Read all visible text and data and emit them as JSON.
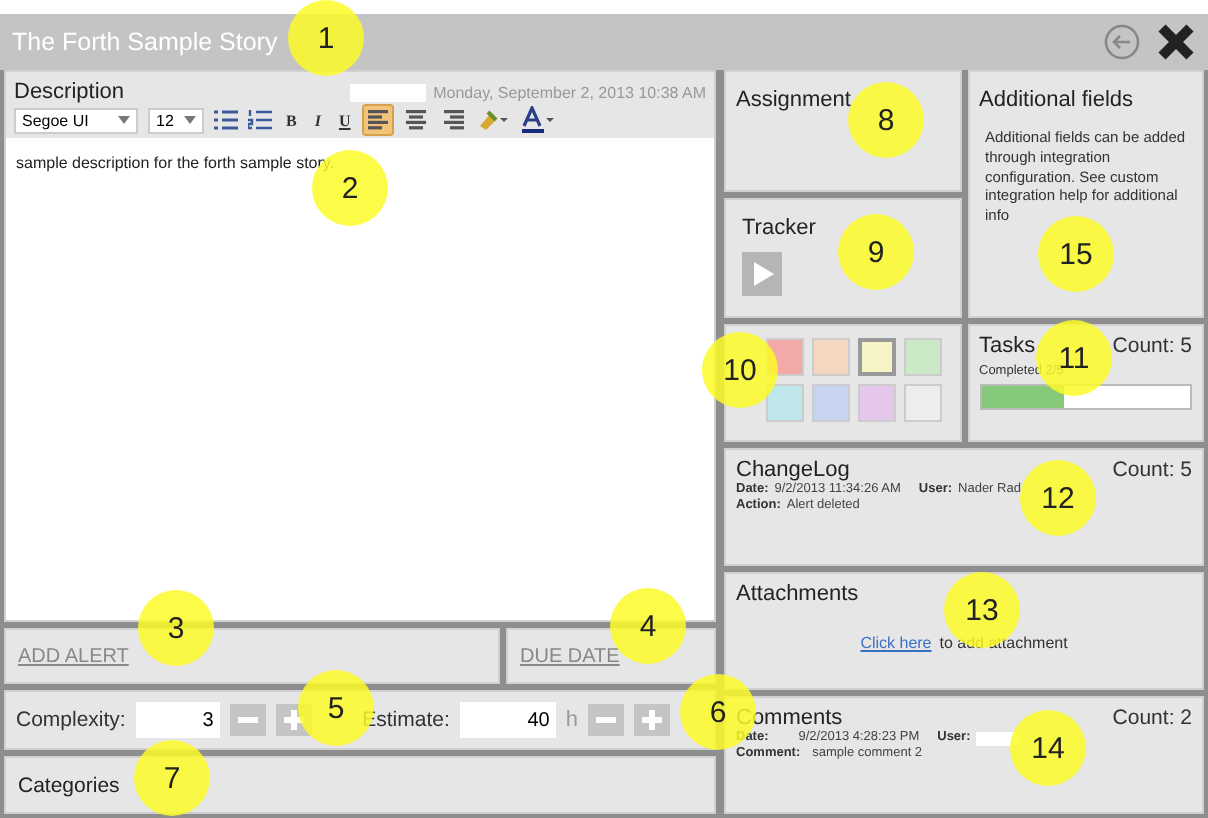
{
  "window": {
    "title": "The Forth Sample Story"
  },
  "description": {
    "title": "Description",
    "date": "Monday, September 2, 2013 10:38 AM",
    "font": "Segoe UI",
    "size": "12",
    "format_buttons": [
      "B",
      "I",
      "U"
    ],
    "align": [
      {
        "kind": "left",
        "selected": true
      },
      {
        "kind": "center",
        "selected": false
      },
      {
        "kind": "right",
        "selected": false
      }
    ],
    "text": "sample description for the forth sample story."
  },
  "add_alert": "ADD ALERT",
  "due_date": "DUE DATE",
  "complexity": {
    "label": "Complexity:",
    "value": "3"
  },
  "estimate": {
    "label": "Estimate:",
    "value": "40",
    "unit": "h"
  },
  "categories": {
    "title": "Categories"
  },
  "assignment": {
    "title": "Assignment"
  },
  "tracker": {
    "title": "Tracker"
  },
  "colors": [
    {
      "color": "#f4a9a9",
      "selected": false
    },
    {
      "color": "#f4d7be",
      "selected": false
    },
    {
      "color": "#f6f3c4",
      "selected": true
    },
    {
      "color": "#cbe9c7",
      "selected": false
    },
    {
      "color": "#bfe7ea",
      "selected": false
    },
    {
      "color": "#c7d4f1",
      "selected": false
    },
    {
      "color": "#e6c7ec",
      "selected": false
    },
    {
      "color": "#ededed",
      "selected": false
    }
  ],
  "additional_fields": {
    "title": "Additional fields",
    "text": "Additional fields can be added through integration configuration. See custom integration help for additional info"
  },
  "tasks": {
    "title": "Tasks",
    "count": "Count: 5",
    "completed": "Completed  2/5",
    "level": 0.4
  },
  "changelog": {
    "title": "ChangeLog",
    "count": "Count: 5",
    "entries": [
      {
        "date_label": "Date:",
        "date": "9/2/2013 11:34:26 AM",
        "user_label": "User:",
        "user": "Nader Rad",
        "action_label": "Action:",
        "action": "Alert deleted"
      }
    ]
  },
  "attachments": {
    "title": "Attachments",
    "link": "Click here",
    "text": "to add attachment"
  },
  "comments": {
    "title": "Comments",
    "count": "Count: 2",
    "entries": [
      {
        "date_label": "Date:",
        "date": "9/2/2013 4:28:23 PM",
        "user_label": "User:",
        "comment_label": "Comment:",
        "comment": "sample comment 2"
      }
    ]
  },
  "callouts": [
    {
      "label": "1"
    },
    {
      "label": "2"
    },
    {
      "label": "3"
    },
    {
      "label": "4"
    },
    {
      "label": "5"
    },
    {
      "label": "6"
    },
    {
      "label": "7"
    },
    {
      "label": "8"
    },
    {
      "label": "9"
    },
    {
      "label": "10"
    },
    {
      "label": "11"
    },
    {
      "label": "12"
    },
    {
      "label": "13"
    },
    {
      "label": "14"
    },
    {
      "label": "15"
    }
  ]
}
